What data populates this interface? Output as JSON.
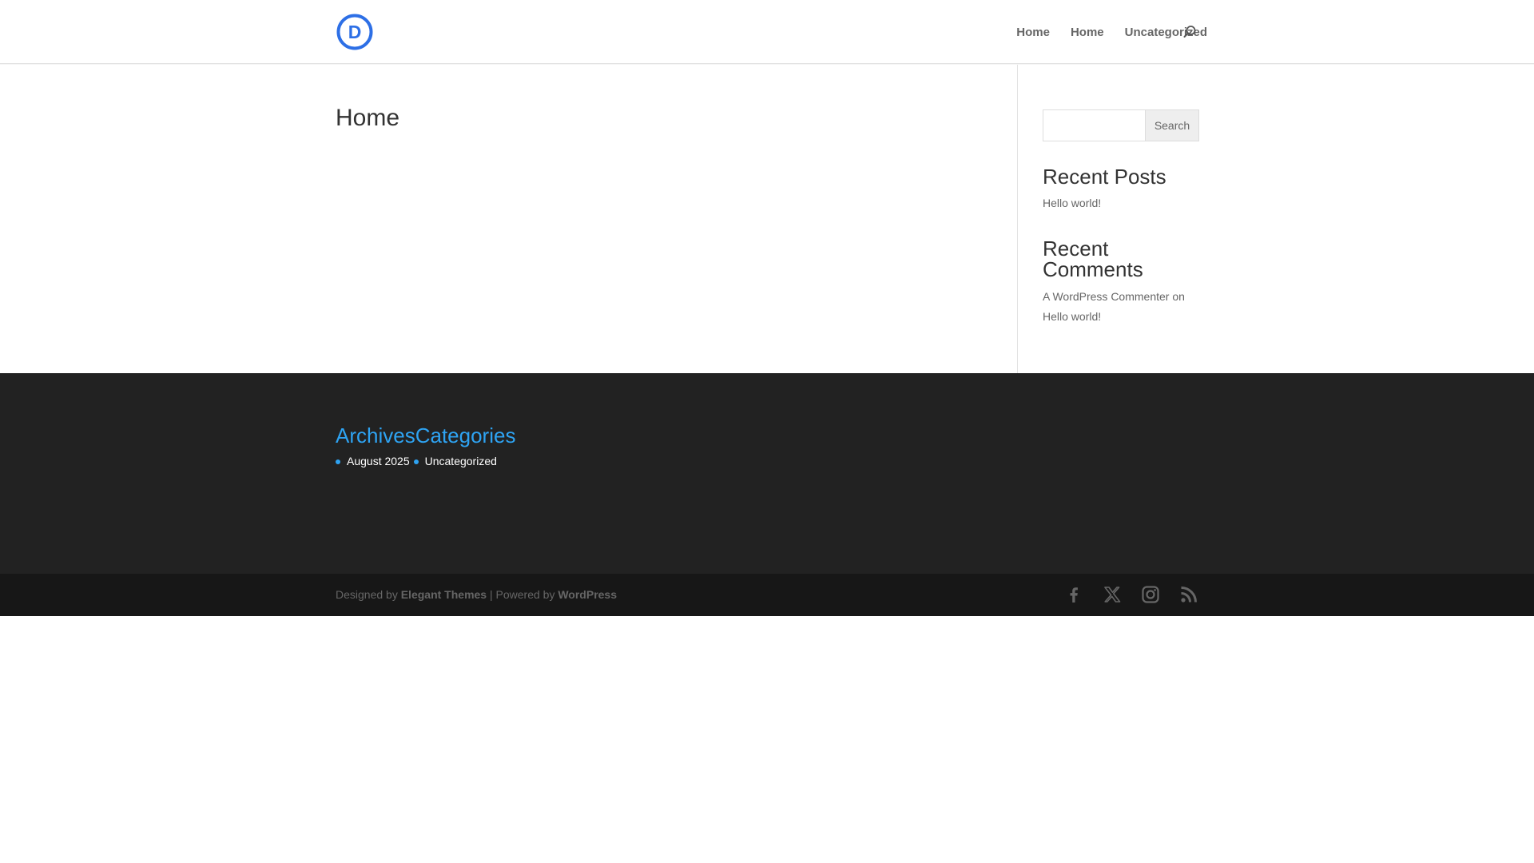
{
  "header": {
    "logo_letter": "D",
    "brand_color": "#2d6fe6",
    "nav": [
      {
        "label": "Home"
      },
      {
        "label": "Home"
      },
      {
        "label": "Uncategorized"
      }
    ],
    "search_icon": "search-icon"
  },
  "main": {
    "page_title": "Home"
  },
  "sidebar": {
    "search": {
      "placeholder": "",
      "button_label": "Search"
    },
    "recent_posts": {
      "title": "Recent Posts",
      "items": [
        "Hello world!"
      ]
    },
    "recent_comments": {
      "title": "Recent Comments",
      "author": "A WordPress Commenter",
      "connector": "on",
      "post": "Hello world!"
    }
  },
  "footer_widgets": {
    "archives_title": "Archives",
    "categories_title": "Categories",
    "archives_item": "August 2025",
    "categories_item": "Uncategorized",
    "accent_color": "#2ea3f2"
  },
  "footer_bottom": {
    "designed_by": "Designed by",
    "theme_name": "Elegant Themes",
    "separator": "| Powered by",
    "platform": "WordPress",
    "social_icons": [
      "facebook-icon",
      "x-icon",
      "instagram-icon",
      "rss-icon"
    ]
  }
}
